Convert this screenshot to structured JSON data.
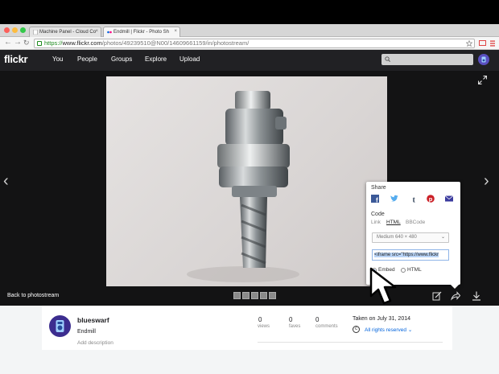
{
  "browser": {
    "tabs": [
      {
        "label": "Machine Panel - Cloud Co"
      },
      {
        "label": "Endmill | Flickr - Photo Sh"
      }
    ],
    "url": {
      "scheme": "https://",
      "host": "www.flickr.com",
      "path": "/photos/49239510@N00/14609661159/in/photostream/"
    }
  },
  "header": {
    "logo": "flickr",
    "nav": [
      "You",
      "People",
      "Groups",
      "Explore",
      "Upload"
    ],
    "search_placeholder": ""
  },
  "viewer": {
    "back_link": "Back to photostream"
  },
  "share": {
    "title": "Share",
    "social": [
      "facebook-icon",
      "twitter-icon",
      "tumblr-icon",
      "pinterest-icon",
      "email-icon"
    ],
    "code_title": "Code",
    "code_tabs": [
      "Link",
      "HTML",
      "BBCode"
    ],
    "active_code_tab": "HTML",
    "size_option": "Medium 640 × 480",
    "embed_code": "<iframe src=\"https://www.flickr",
    "radios": [
      {
        "label": "Embed",
        "checked": true
      },
      {
        "label": "HTML",
        "checked": false
      }
    ]
  },
  "info": {
    "username": "blueswarf",
    "photo_title": "Endmill",
    "add_description": "Add description",
    "stats": [
      {
        "value": "0",
        "label": "views"
      },
      {
        "value": "0",
        "label": "faves"
      },
      {
        "value": "0",
        "label": "comments"
      }
    ],
    "taken": "Taken on July 31, 2014",
    "rights": "All rights reserved"
  },
  "colors": {
    "flickr_header": "#212124",
    "flickr_blue": "#0063dc",
    "flickr_pink": "#ff0084"
  }
}
